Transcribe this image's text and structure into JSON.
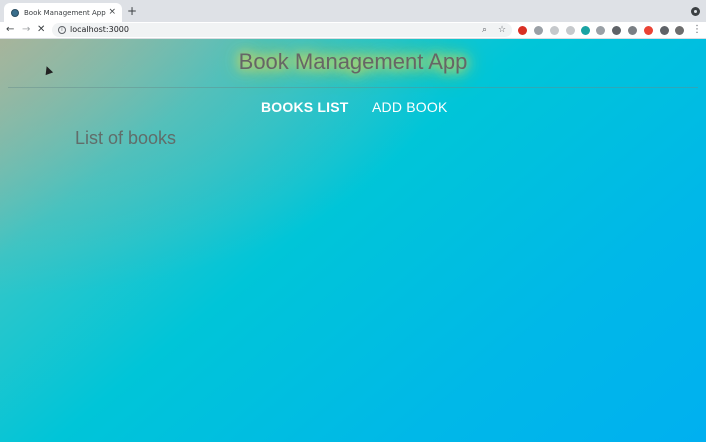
{
  "browser": {
    "tab_title": "Book Management App",
    "tab_close": "×",
    "new_tab": "+",
    "back_glyph": "←",
    "forward_glyph": "→",
    "reload_glyph": "✕",
    "url": "localhost:3000",
    "menu_glyph": "⋮",
    "extension_colors": [
      "#d93025",
      "#9aa0a6",
      "#c6c9cc",
      "#c6c9cc",
      "#1aa3a3",
      "#9aa0a6",
      "#5f6368",
      "#7a7f84",
      "#ea4335",
      "#5f6368",
      "#6d6d6d"
    ]
  },
  "app": {
    "title": "Book Management App",
    "nav": {
      "books_list": "BOOKS LIST",
      "add_book": "ADD BOOK"
    },
    "section_title": "List of books"
  },
  "colors": {
    "title_glow": "#f5e24a",
    "gradient_start": "#a3bba2",
    "gradient_end": "#00b0f0"
  }
}
